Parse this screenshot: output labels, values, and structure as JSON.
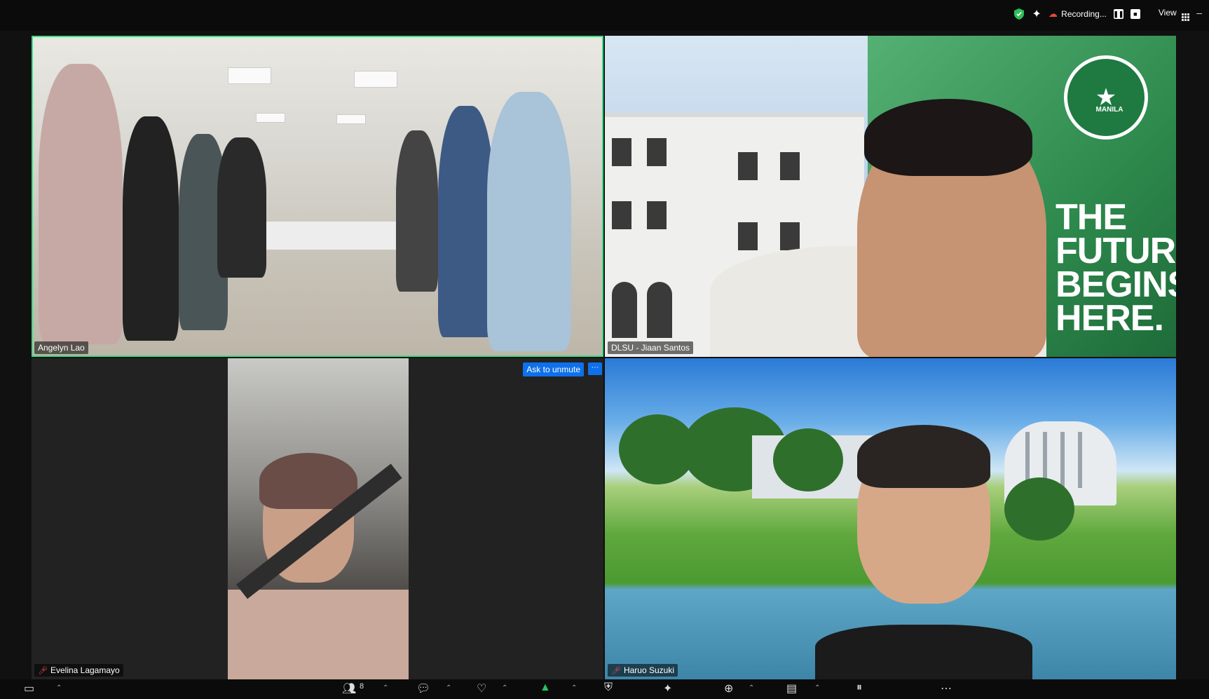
{
  "topbar": {
    "recording_label": "Recording...",
    "view_label": "View",
    "minimize": "–"
  },
  "participants": [
    {
      "name": "Angelyn Lao",
      "muted": false,
      "speaking": true
    },
    {
      "name": "DLSU - Jiaan Santos",
      "muted": false,
      "speaking": false
    },
    {
      "name": "Evelina Lagamayo",
      "muted": true,
      "speaking": false
    },
    {
      "name": "Haruo Suzuki",
      "muted": true,
      "speaking": false
    }
  ],
  "tile3": {
    "ask_to_unmute": "Ask to unmute",
    "more": "···"
  },
  "background_text": {
    "seal_text": "MANILA",
    "slogan": "THE FUTURE BEGINS HERE."
  },
  "bottombar": {
    "participants_count": "8"
  },
  "colors": {
    "speaking_border": "#3ddc84",
    "accent_blue": "#0e71eb",
    "mute_red": "#e5484d"
  }
}
